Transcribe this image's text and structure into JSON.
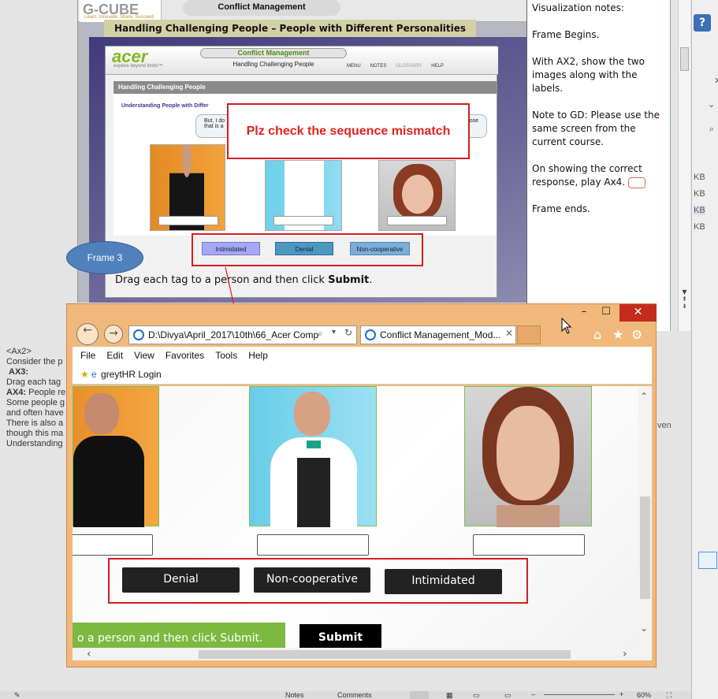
{
  "slide": {
    "brand": "G-CUBE",
    "brand_tagline": "Learn. Innovate. Share. Succeed.",
    "top_title": "Conflict Management",
    "heading": "Handling Challenging People – People with Different Personalities",
    "course": {
      "logo": "acer",
      "logo_tagline": "explore beyond limits™",
      "title": "Conflict Management",
      "subtitle": "Handling Challenging People",
      "menu": [
        "MENU",
        "NOTES",
        "GLOSSARY",
        "HELP"
      ],
      "section_title": "Handling Challenging People",
      "section_sub": "Understanding People with Differ",
      "speech_text": "But, I do",
      "speech_text_2": "that is a",
      "speech_text_right": "ose",
      "tags": [
        "Intimidated",
        "Denial",
        "Non-cooperative"
      ],
      "instruction_pre": "Drag each tag to a person and then click ",
      "instruction_bold": "Submit",
      "instruction_post": "."
    },
    "annotation": "Plz check the sequence mismatch",
    "frame_label": "Frame 3"
  },
  "notes_panel": {
    "lines": [
      "Visualization notes:",
      "Frame Begins.",
      "With AX2, show the two images along with the labels.",
      "Note to GD: Please use the same screen from the current course.",
      "On showing the correct response, play Ax4.",
      "Frame ends."
    ]
  },
  "left_notes": {
    "l1": "<Ax2>",
    "l2": "Consider the p",
    "l3": "AX3:",
    "l4": "Drag each tag",
    "l5": "AX4:",
    "l5b": "People re",
    "l6": "Some people g",
    "l7": "and often have",
    "l8": "There is also a",
    "l9": "though this ma",
    "l10": "Understanding"
  },
  "right_pane": {
    "kb": [
      "KB",
      "KB",
      "KB",
      "KB"
    ],
    "fragment": "ven"
  },
  "browser": {
    "address": "D:\\Divya\\April_2017\\10th\\66_Acer Comp",
    "tab_title": "Conflict Management_Mod...",
    "menu": [
      "File",
      "Edit",
      "View",
      "Favorites",
      "Tools",
      "Help"
    ],
    "favorite": "greytHR Login",
    "buttons": [
      "Denial",
      "Non-cooperative",
      "Intimidated"
    ],
    "instruction": "o a person and then click Submit.",
    "submit": "Submit"
  },
  "status_bar": {
    "notes": "Notes",
    "comments": "Comments",
    "zoom": "60%"
  }
}
